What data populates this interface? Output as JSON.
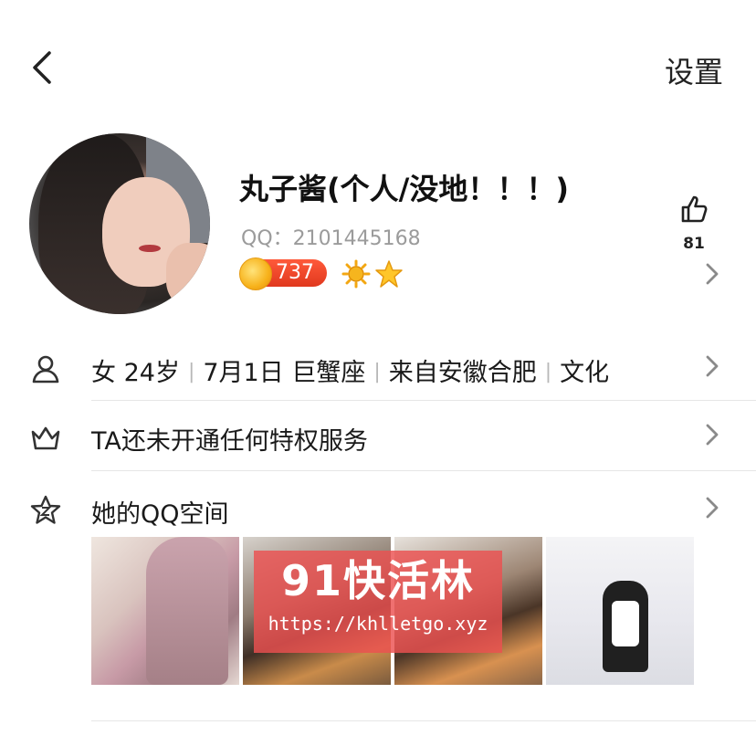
{
  "header": {
    "settings_label": "设置"
  },
  "profile": {
    "nickname": "丸子酱(个人/没地！！！)",
    "qq_line": "QQ：2101445168",
    "level": "737",
    "likes": "81"
  },
  "info_row": {
    "gender": "女",
    "age": "24岁",
    "birthday": "7月1日 巨蟹座",
    "location": "来自安徽合肥",
    "occupation": "文化"
  },
  "vip_row": {
    "label": "TA还未开通任何特权服务"
  },
  "qzone": {
    "label": "她的QQ空间",
    "photos_count_shown": 4
  },
  "watermark": {
    "title": "91快活林",
    "url": "https://khlletgo.xyz"
  },
  "colors": {
    "level_badge": "#e8462a",
    "coin": "#f7b21b",
    "watermark": "#eb5050"
  }
}
